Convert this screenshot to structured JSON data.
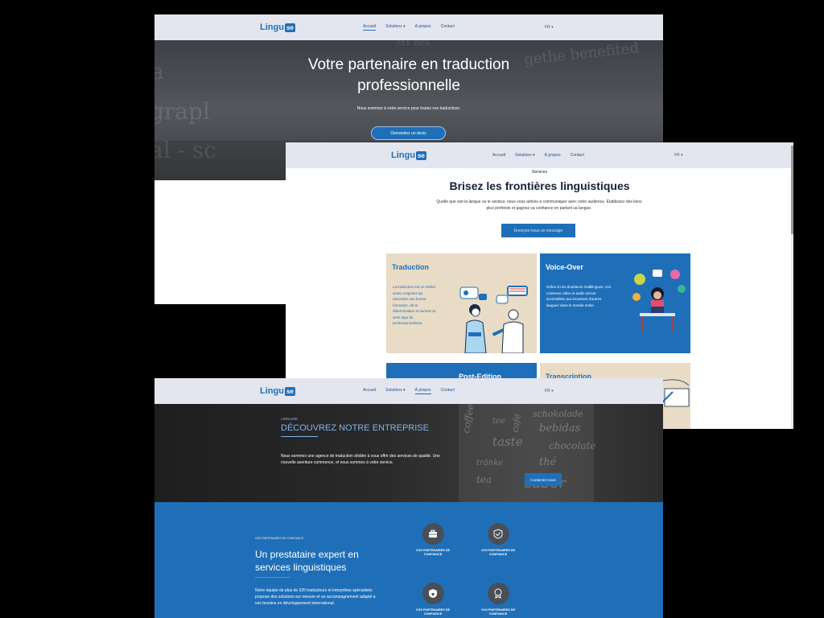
{
  "brand": {
    "name": "Lingu",
    "badge": "se"
  },
  "nav": {
    "items": [
      "Accueil",
      "Solutions",
      "À propos",
      "Contact"
    ],
    "dropdown_arrow": "▾",
    "lang": "FR"
  },
  "win1": {
    "hero_title": "Votre partenaire en traduction professionnelle",
    "hero_sub": "Nous sommes à votre service pour toutes vos traductions.",
    "cta": "Demandez un devis"
  },
  "win2": {
    "eyebrow": "Services",
    "title": "Brisez les frontières linguistiques",
    "lead": "Quelle que soit la langue ou le secteur, nous vous aidons à communiquer avec votre audience. Établissez des liens plus profonds et gagnez sa confiance en parlant sa langue.",
    "cta": "Envoyez-nous un message",
    "cards": [
      {
        "title": "Traduction",
        "text": "La traduction est un métier assez exigeant qui nécessite une bonne formation, de la détermination et surtout un sens aigu du professionnalisme."
      },
      {
        "title": "Voice-Over",
        "text": "Grâce à nos doubleurs multilingues, vos contenus vidéo et audio seront accessibles aux locuteurs d'autres langues dans le monde entier."
      },
      {
        "title": "Post-Edition",
        "text": ""
      },
      {
        "title": "Transcription",
        "text": ""
      }
    ]
  },
  "win3": {
    "eyebrow": "LINGUISE",
    "title": "DÉCOUVREZ NOTRE ENTREPRISE",
    "text": "Nous sommes une agence de traduction dédiée à vous offrir des services de qualité. Une nouvelle aventure commence, et nous sommes à votre service.",
    "cta": "Contactez-nous",
    "blue": {
      "kicker": "VOS PARTENAIRES DE CONFIANCE",
      "title": "Un prestataire expert en services linguistiques",
      "text": "Notre équipe de plus de 320 traducteurs et interprètes spécialisés propose des solutions sur mesure et un accompagnement adapté à vos besoins en développement international.",
      "features": [
        {
          "label": "VOS PARTENAIRES DE CONFIANCE",
          "icon": "briefcase-icon"
        },
        {
          "label": "VOS PARTENAIRES DE CONFIANCE",
          "icon": "shield-check-icon"
        },
        {
          "label": "VOS PARTENAIRES DE CONFIANCE",
          "icon": "shield-lock-icon"
        },
        {
          "label": "VOS PARTENAIRES DE CONFIANCE",
          "icon": "award-icon"
        }
      ]
    }
  },
  "colors": {
    "primary": "#1f6fb8",
    "nav_bg": "#e3e6ef",
    "card_beige": "#e8dcc7",
    "dark": "#14203a"
  }
}
